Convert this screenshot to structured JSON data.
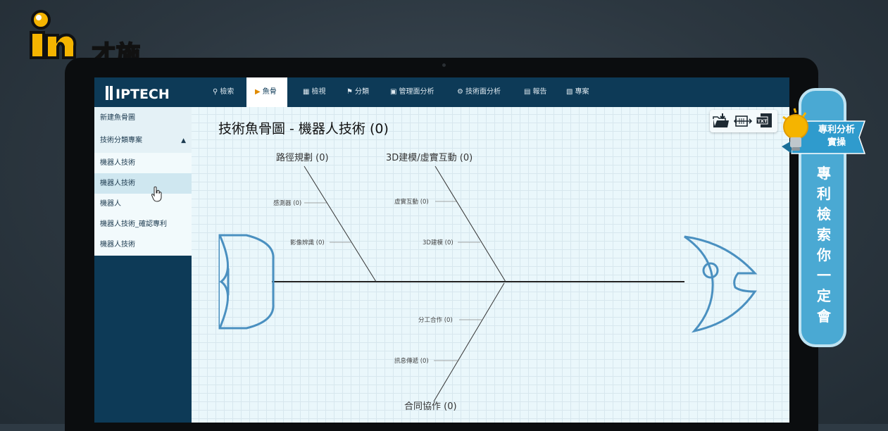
{
  "brand": {
    "name": "才施教",
    "mark": "in"
  },
  "app": {
    "logo_text": "IPTECH"
  },
  "nav": [
    {
      "label": "檢索",
      "icon": "search-icon"
    },
    {
      "label": "魚骨",
      "icon": "fishbone-icon",
      "active": true
    },
    {
      "label": "檢視",
      "icon": "view-icon"
    },
    {
      "label": "分類",
      "icon": "classify-icon"
    },
    {
      "label": "管理面分析",
      "icon": "monitor-icon"
    },
    {
      "label": "技術面分析",
      "icon": "gears-icon"
    },
    {
      "label": "報告",
      "icon": "report-icon"
    },
    {
      "label": "專案",
      "icon": "project-icon"
    }
  ],
  "sidebar": {
    "new_label": "新建魚骨圖",
    "group_label": "技術分類專案",
    "items": [
      "機器人技術",
      "機器人技術",
      "機器人",
      "機器人技術_確認專利",
      "機器人技術"
    ],
    "hovered_index": 1
  },
  "main": {
    "title": "技術魚骨圖 - 機器人技術 (0)"
  },
  "fishbone": {
    "top_left": {
      "label": "路徑規劃 (0)",
      "subs": [
        "感測器 (0)",
        "影像辨識 (0)"
      ]
    },
    "top_right": {
      "label": "3D建模/虛實互動 (0)",
      "subs": [
        "虛實互動 (0)",
        "3D建模 (0)"
      ]
    },
    "bottom": {
      "label": "合同協作 (0)",
      "subs": [
        "分工合作 (0)",
        "訊息傳遞 (0)"
      ]
    }
  },
  "toolbar": {
    "icons": [
      "folder-download-icon",
      "export-arrows-icon",
      "txt-export-icon"
    ],
    "txt_badge": "TXT"
  },
  "promo": {
    "banner_line1": "專利分析",
    "banner_line2": "實操",
    "vertical": [
      "專",
      "利",
      "檢",
      "索",
      "你",
      "一",
      "定",
      "會"
    ]
  },
  "colors": {
    "nav_bg": "#0d3a57",
    "accent": "#4aa9d3",
    "fish_outline": "#4a90c0"
  }
}
